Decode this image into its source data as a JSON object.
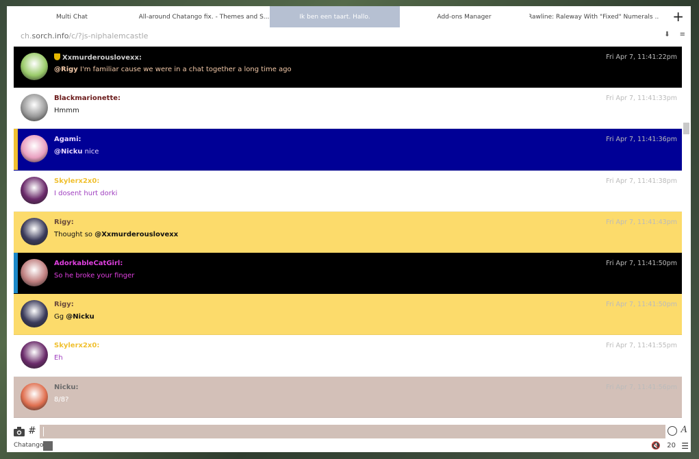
{
  "tabs": [
    {
      "label": "Multi Chat"
    },
    {
      "label": "All-around Chatango fix. - Themes and S..."
    },
    {
      "label": "Ik ben een taart. Hallo."
    },
    {
      "label": "Add-ons Manager"
    },
    {
      "label": "Rawline: Raleway With \"Fixed\" Numerals ..."
    }
  ],
  "tab_add_label": "+",
  "url": {
    "prefix": "ch.",
    "domain": "sorch.info",
    "path": "/c/?js-niphalemcastle"
  },
  "messages": [
    {
      "name": "Xxmurderouslovexx:",
      "mention": "@Rigy",
      "text": " I'm familiar cause we were in a chat together a long time ago",
      "time": "Fri Apr 7, 11:41:22pm",
      "bg": "#000000",
      "name_color": "#cfcfcf",
      "text_color": "#f2c8a8",
      "accent": "#000000",
      "avatar": "#9acb6a",
      "badge": true
    },
    {
      "name": "Blackmarionette:",
      "mention": "",
      "text": "Hmmm",
      "time": "Fri Apr 7, 11:41:33pm",
      "bg": "#ffffff",
      "name_color": "#6a1a1a",
      "text_color": "#222222",
      "accent": "#ffffff",
      "avatar": "#999999",
      "badge": false
    },
    {
      "name": "Agami:",
      "mention": "@Nicku",
      "text": " nice",
      "time": "Fri Apr 7, 11:41:36pm",
      "bg": "#000096",
      "name_color": "#e8d8ff",
      "text_color": "#e8d8ff",
      "accent": "#f0c030",
      "avatar": "#e9a0c0",
      "badge": false
    },
    {
      "name": "Skylerx2x0:",
      "mention": "",
      "text": "I dosent hurt dorki",
      "time": "Fri Apr 7, 11:41:38pm",
      "bg": "#ffffff",
      "name_color": "#f0c030",
      "text_color": "#a040c0",
      "accent": "#ffffff",
      "avatar": "#6a2a6a",
      "badge": false
    },
    {
      "name": "Rigy:",
      "mention": "@Xxmurderouslovexx",
      "text": "Thought so ",
      "mention_after": true,
      "time": "Fri Apr 7, 11:41:43pm",
      "bg": "#fcdb6b",
      "name_color": "#6a4a3a",
      "text_color": "#111111",
      "accent": "#fcdb6b",
      "avatar": "#3a3a5a",
      "badge": false
    },
    {
      "name": "AdorkableCatGirl:",
      "mention": "",
      "text": "So he broke your finger",
      "time": "Fri Apr 7, 11:41:50pm",
      "bg": "#000000",
      "name_color": "#e040e0",
      "text_color": "#e040e0",
      "accent": "#1a88c8",
      "avatar": "#c08080",
      "badge": false
    },
    {
      "name": "Rigy:",
      "mention": "@Nicku",
      "text": "Gg ",
      "mention_after": true,
      "time": "Fri Apr 7, 11:41:50pm",
      "bg": "#fcdb6b",
      "name_color": "#6a4a3a",
      "text_color": "#111111",
      "accent": "#fcdb6b",
      "avatar": "#3a3a5a",
      "badge": false
    },
    {
      "name": "Skylerx2x0:",
      "mention": "",
      "text": "Eh",
      "time": "Fri Apr 7, 11:41:55pm",
      "bg": "#ffffff",
      "name_color": "#f0c030",
      "text_color": "#a040c0",
      "accent": "#ffffff",
      "avatar": "#6a2a6a",
      "badge": false
    },
    {
      "name": "Nicku:",
      "mention": "",
      "text": "8/8?",
      "time": "Fri Apr 7, 11:41:56pm",
      "bg": "#d3c0b8",
      "name_color": "#6a6a6a",
      "text_color": "#ffffff",
      "accent": "#d3c0b8",
      "avatar": "#e07050",
      "badge": false
    }
  ],
  "input": {
    "value": ""
  },
  "status": {
    "brand": "Chatango",
    "count": "20"
  },
  "icons": {
    "camera": "camera-icon",
    "hash": "#",
    "emoji": "smiley-icon",
    "font": "A",
    "mute": "🔇",
    "menu": "☰"
  }
}
